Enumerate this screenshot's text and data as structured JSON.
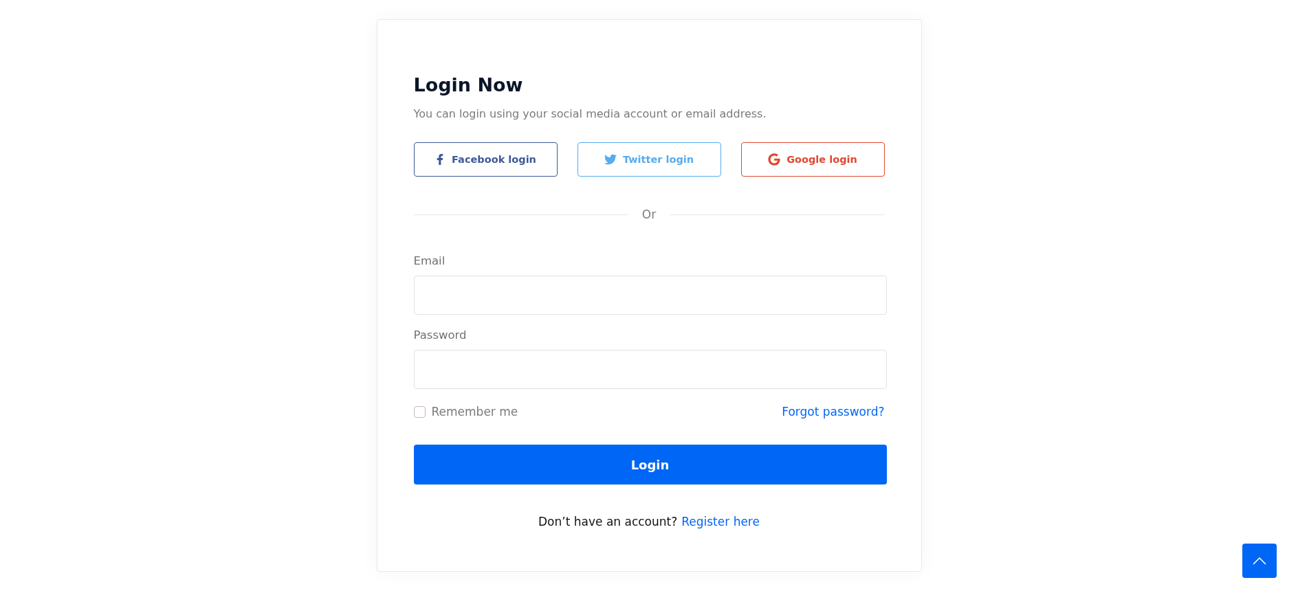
{
  "title": "Login Now",
  "subtitle": "You can login using your social media account or email address.",
  "social_buttons": [
    {
      "kind": "facebook",
      "label": "Facebook login",
      "color": "#3b5998"
    },
    {
      "kind": "twitter",
      "label": "Twitter login",
      "color": "#55acee"
    },
    {
      "kind": "google",
      "label": "Google login",
      "color": "#e0482f"
    }
  ],
  "divider_text": "Or",
  "fields": [
    {
      "label": "Email"
    },
    {
      "label": "Password"
    }
  ],
  "remember": {
    "label": "Remember me",
    "checked": false
  },
  "forgot_link": "Forgot password?",
  "submit": "Login",
  "footer": {
    "text": "Don’t have an account?",
    "link": "Register here"
  }
}
